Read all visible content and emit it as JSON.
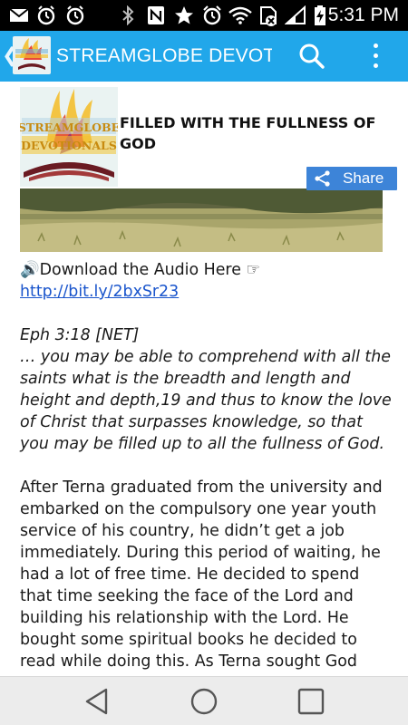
{
  "status_bar": {
    "time": "5:31 PM",
    "icons": [
      "mail-icon",
      "alarm-clock-icon",
      "alarm-clock-icon",
      "bluetooth-icon",
      "nfc-icon",
      "star-icon",
      "alarm-icon",
      "wifi-icon",
      "no-sim-icon",
      "signal-icon",
      "battery-charging-icon"
    ]
  },
  "app_bar": {
    "title": "STREAMGLOBE DEVOTIONALS",
    "logo_text": [
      "STREAMGLOBE",
      "DEVOTIONALS"
    ],
    "icons": [
      "back-chevron-icon",
      "search-icon",
      "overflow-menu-icon"
    ],
    "color": "#21a7ea"
  },
  "post": {
    "title_line1": "FILLED WITH THE FULLNESS OF",
    "title_line2": "GOD",
    "logo_text": [
      "STREAMGLOBE",
      "DEVOTIONALS"
    ],
    "share_label": "Share",
    "share_color": "#3d84d8"
  },
  "article": {
    "audio_speaker": "🔊",
    "audio_text": "Download the Audio Here",
    "audio_pointer": "☞",
    "audio_link": "http://bit.ly/2bxSr23",
    "scripture_ref": "Eph 3:18 [NET]",
    "scripture_lines": [
      "… you may be able to comprehend with all the",
      "saints what is the breadth and length and",
      "height and depth,19 and thus to know the love",
      "of Christ that surpasses knowledge, so that",
      "you may be filled up to all the fullness of God."
    ],
    "body_lines": [
      "After Terna graduated from the university and",
      "embarked on the compulsory one year youth",
      "service of his country, he didn’t get a job",
      "immediately. During this period of waiting, he",
      "had a lot of free time. He decided to spend",
      "that time seeking the face of the Lord and",
      "building his relationship with the Lord. He",
      "bought some spiritual books he decided to",
      "read while doing this. As Terna sought God"
    ]
  },
  "nav_bar": {
    "icons": [
      "back-triangle-icon",
      "home-circle-icon",
      "recents-square-icon"
    ]
  }
}
